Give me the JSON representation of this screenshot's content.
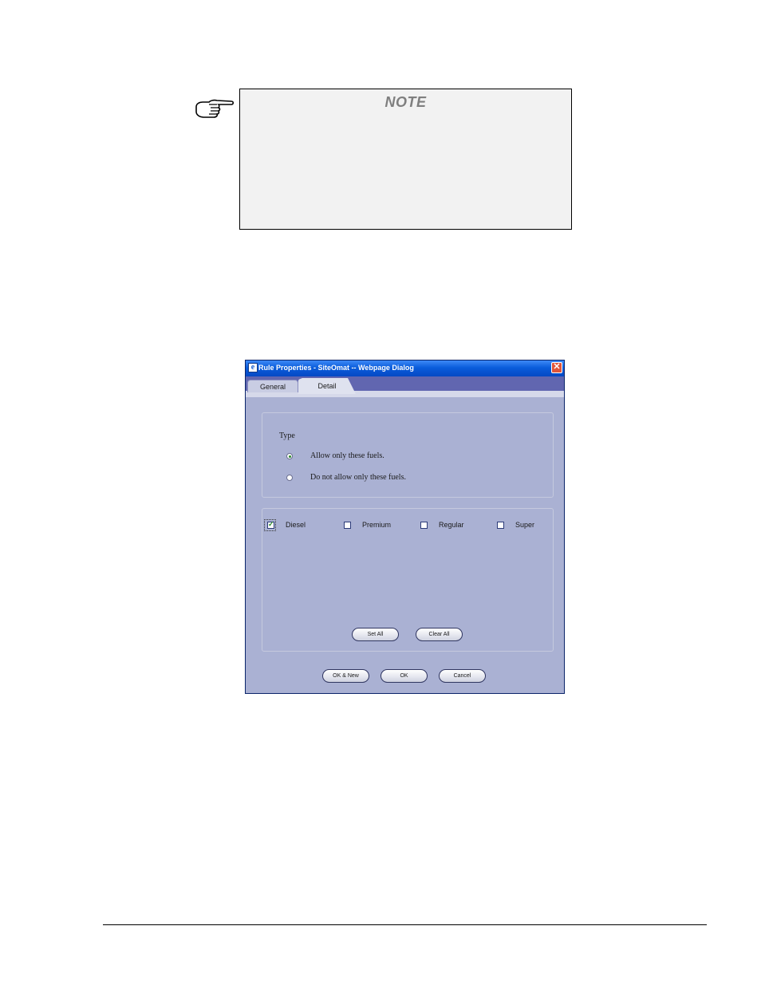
{
  "note": {
    "title": "NOTE",
    "icon": "pointing-hand-icon"
  },
  "dialog": {
    "title": "Rule Properties - SiteOmat -- Webpage Dialog",
    "title_icon": "ie-page-icon",
    "close_icon": "close-icon",
    "close_glyph": "✕",
    "tabs": [
      {
        "label": "General",
        "selected": false
      },
      {
        "label": "Detail",
        "selected": true
      }
    ],
    "type_group": {
      "label": "Type",
      "options": [
        {
          "label": "Allow only these fuels.",
          "selected": true
        },
        {
          "label": "Do not allow only these fuels.",
          "selected": false
        }
      ]
    },
    "fuels": [
      {
        "label": "Diesel",
        "checked": true
      },
      {
        "label": "Premium",
        "checked": false
      },
      {
        "label": "Regular",
        "checked": false
      },
      {
        "label": "Super",
        "checked": false
      }
    ],
    "buttons": {
      "set_all": "Set All",
      "clear_all": "Clear All",
      "ok_new": "OK & New",
      "ok": "OK",
      "cancel": "Cancel"
    },
    "colors": {
      "dialog_bg": "#aab1d3",
      "titlebar": "#0a5ddb",
      "tabstrip": "#6166b0"
    }
  }
}
